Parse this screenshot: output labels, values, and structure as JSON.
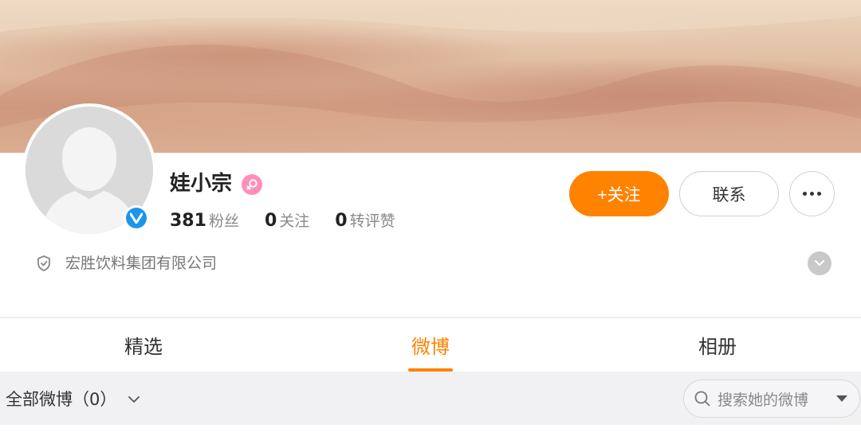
{
  "profile": {
    "name": "娃小宗",
    "gender_icon": "female-icon",
    "verified_icon": "verified-v-icon",
    "company": "宏胜饮料集团有限公司"
  },
  "stats": [
    {
      "num": "381",
      "label": "粉丝"
    },
    {
      "num": "0",
      "label": "关注"
    },
    {
      "num": "0",
      "label": "转评赞"
    }
  ],
  "actions": {
    "follow_label": "+关注",
    "contact_label": "联系",
    "more_icon": "more-dots-icon"
  },
  "tabs": [
    {
      "label": "精选",
      "active": false
    },
    {
      "label": "微博",
      "active": true
    },
    {
      "label": "相册",
      "active": false
    }
  ],
  "filter": {
    "label": "全部微博（0）"
  },
  "search": {
    "placeholder": "搜索她的微博"
  },
  "colors": {
    "accent": "#ff8200",
    "verified": "#1c95ea",
    "gender": "#ff8fb8"
  }
}
